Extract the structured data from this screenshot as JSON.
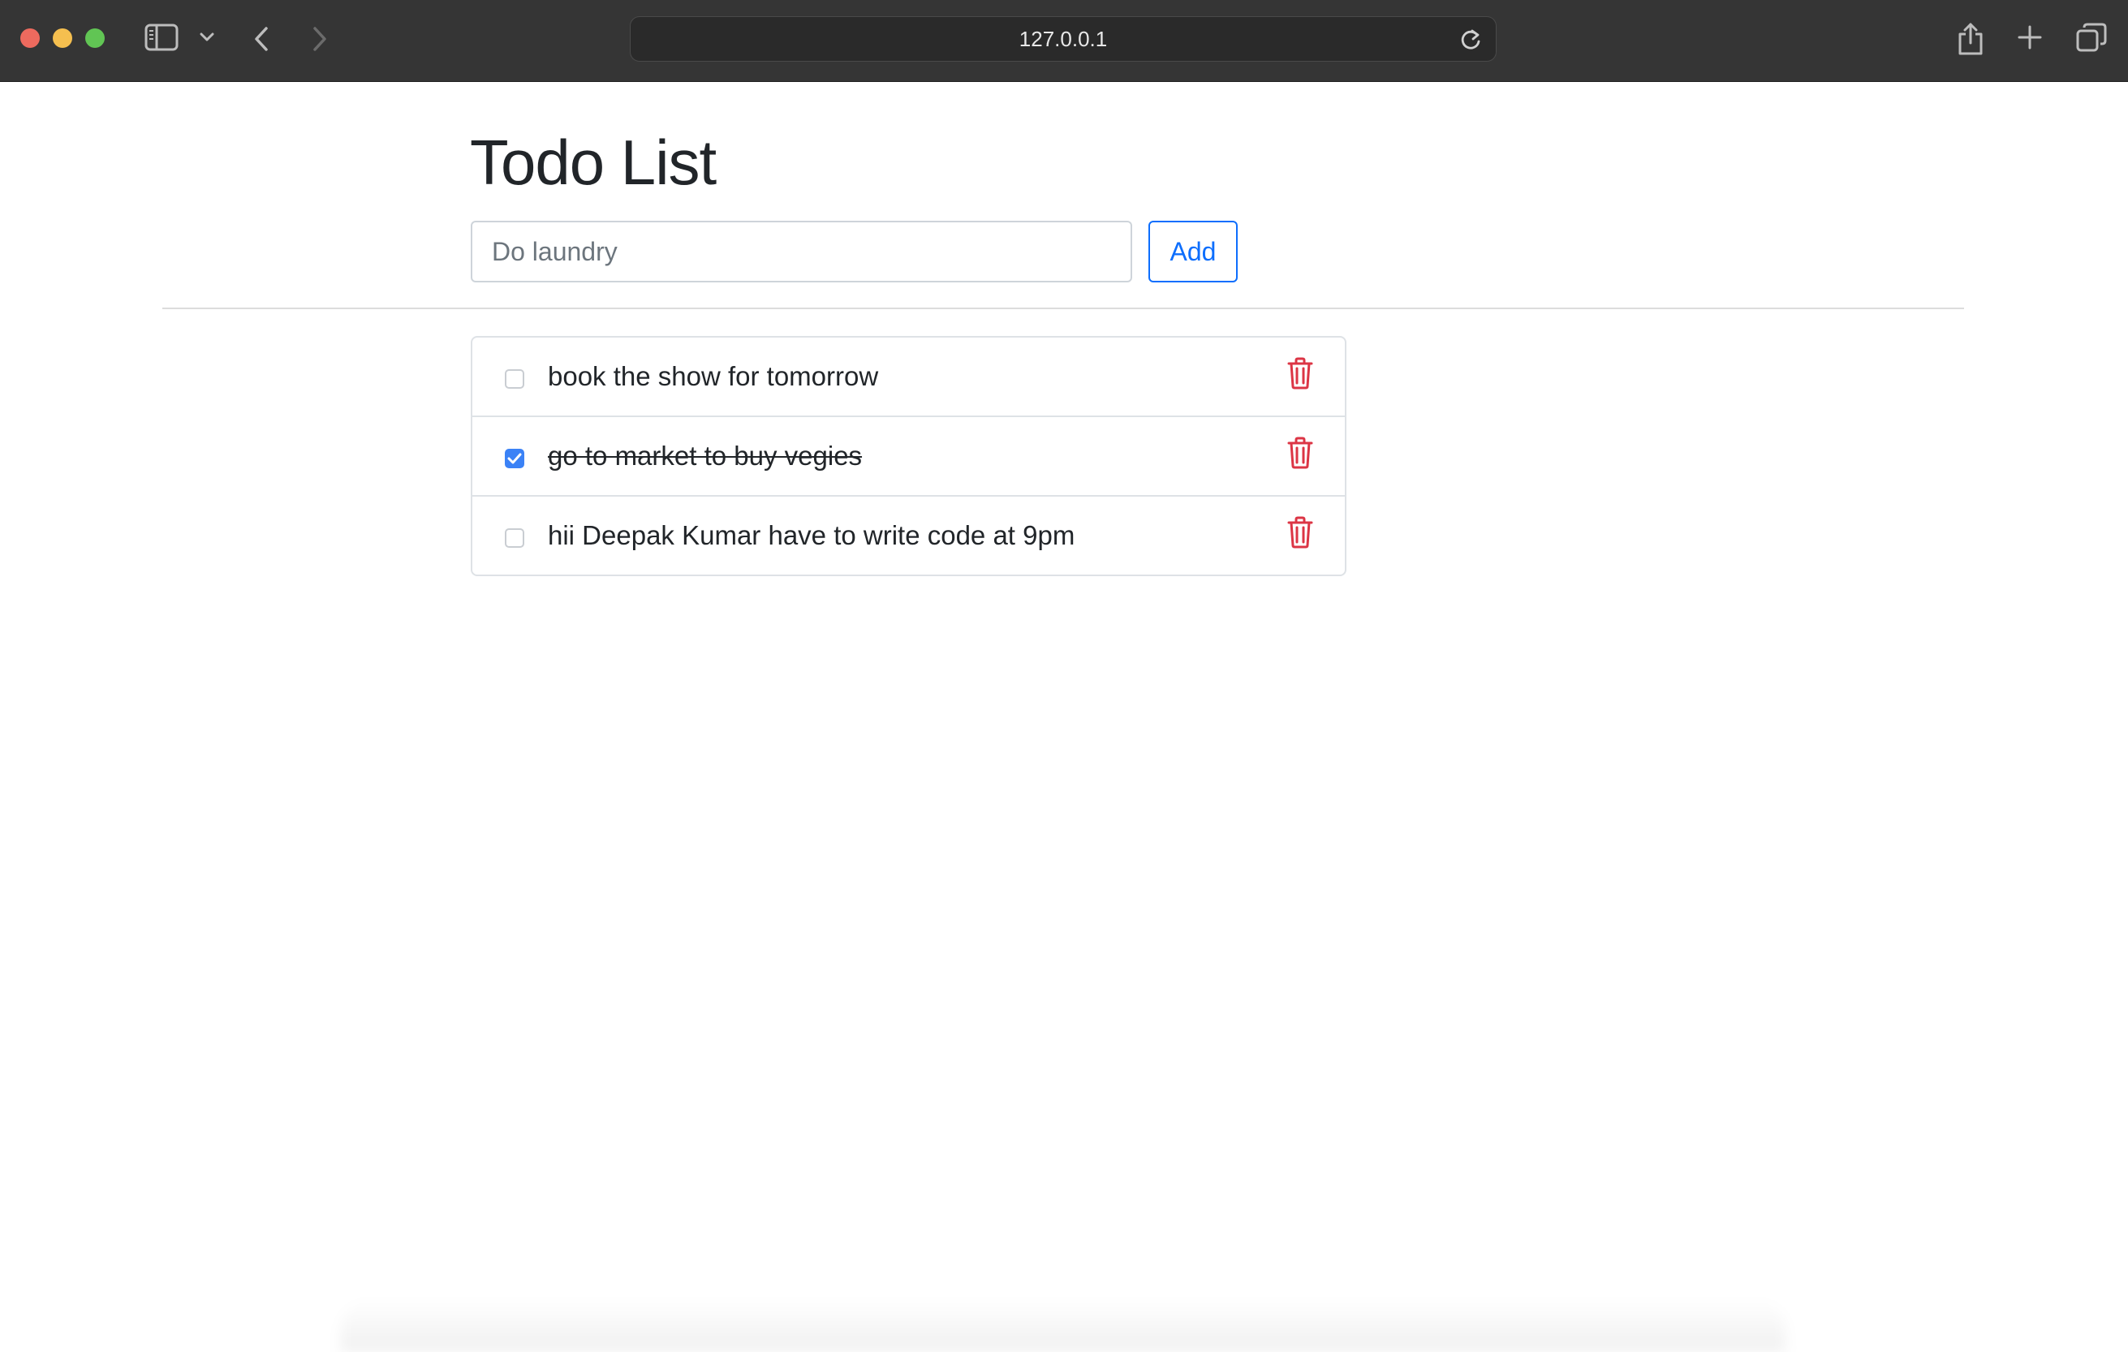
{
  "browser": {
    "url": "127.0.0.1",
    "icons": {
      "sidebar": "sidebar-icon",
      "sidebar_menu": "chevron-down-icon",
      "back": "chevron-left-icon",
      "forward": "chevron-right-icon",
      "reload": "reload-icon",
      "share": "share-icon",
      "new_tab": "plus-icon",
      "tabs": "tab-overview-icon"
    }
  },
  "page": {
    "title": "Todo List",
    "input_placeholder": "Do laundry",
    "input_value": "",
    "add_label": "Add",
    "accent_color": "#0d6efd",
    "delete_color": "#dc3545"
  },
  "todos": [
    {
      "text": "book the show for tomorrow",
      "done": false
    },
    {
      "text": "go to market to buy vegies",
      "done": true
    },
    {
      "text": "hii Deepak Kumar have to write code at 9pm",
      "done": false
    }
  ]
}
